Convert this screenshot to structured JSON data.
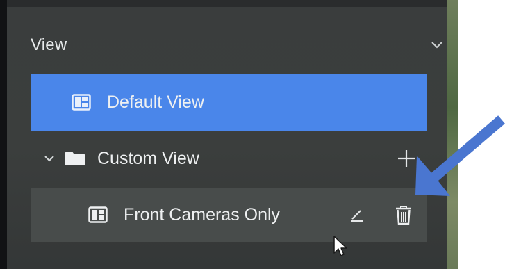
{
  "view_panel": {
    "title": "View",
    "collapse_icon": "chevron-down-icon",
    "items": [
      {
        "label": "Default View",
        "icon": "view-layout-icon",
        "selected": true
      },
      {
        "label": "Custom View",
        "icon": "folder-icon",
        "expanded": true,
        "action_icon": "plus-icon"
      },
      {
        "label": "Front Cameras Only",
        "icon": "view-layout-icon",
        "actions": [
          "edit-icon",
          "trash-icon"
        ]
      }
    ]
  },
  "colors": {
    "panel_bg": "#3b3e3d",
    "selected_bg": "#4a86ea",
    "hover_bg": "#484c4b",
    "annotation_arrow": "#4a76d0"
  }
}
